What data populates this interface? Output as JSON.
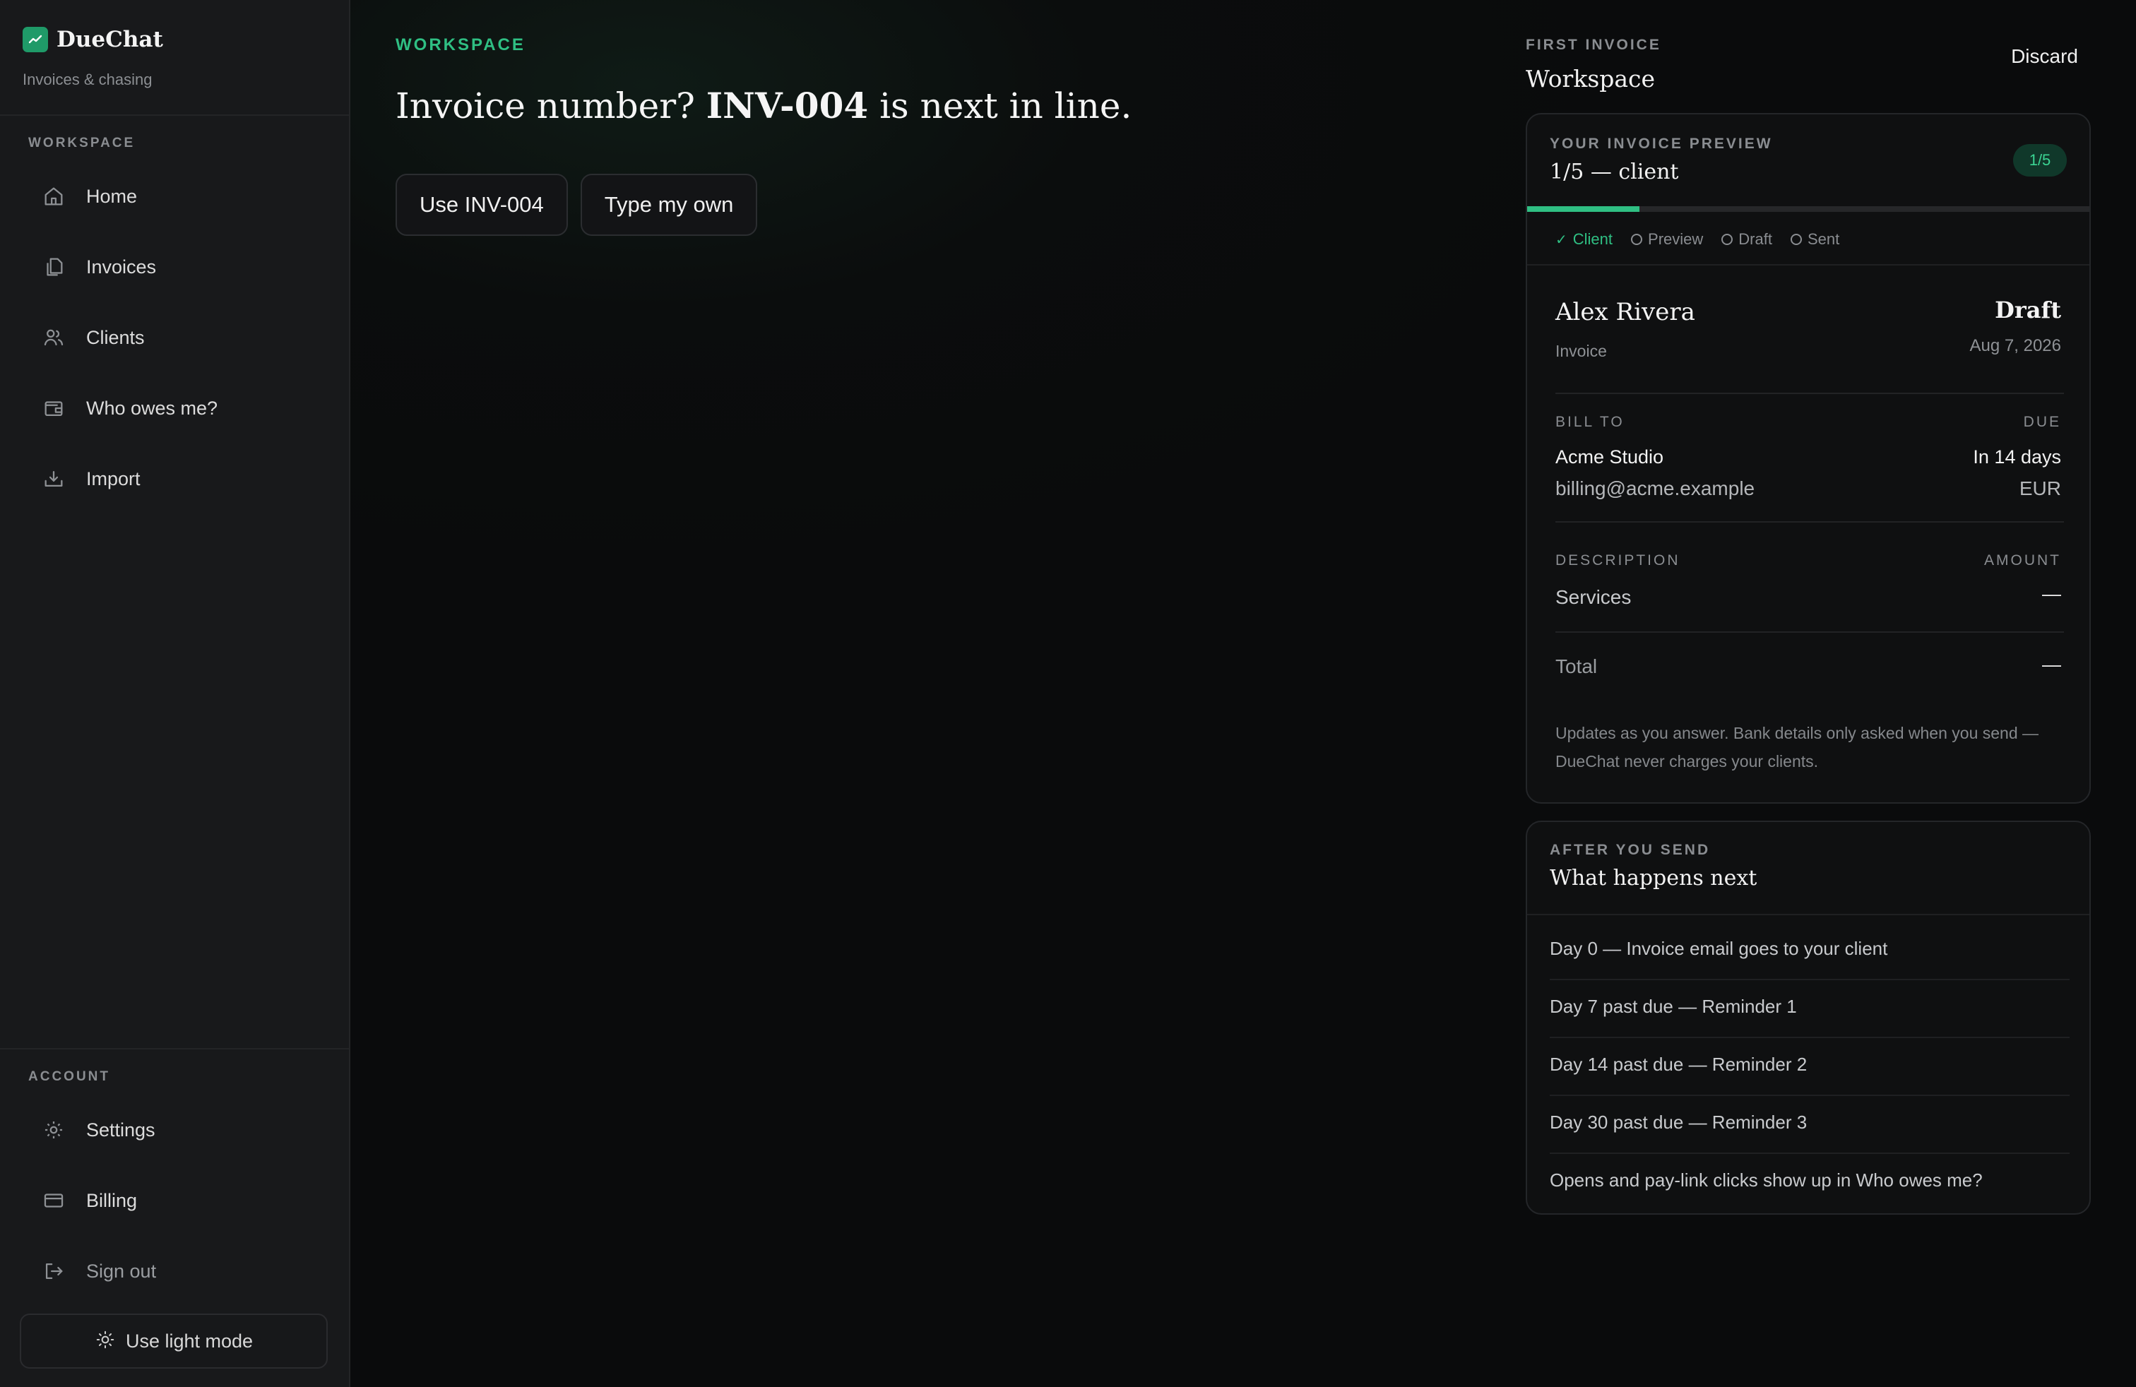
{
  "brand": {
    "name": "DueChat",
    "subtitle": "Invoices & chasing"
  },
  "sidebar": {
    "workspace_heading": "WORKSPACE",
    "items": [
      {
        "label": "Home",
        "icon": "home-icon"
      },
      {
        "label": "Invoices",
        "icon": "documents-icon"
      },
      {
        "label": "Clients",
        "icon": "users-icon"
      },
      {
        "label": "Who owes me?",
        "icon": "wallet-icon"
      },
      {
        "label": "Import",
        "icon": "import-icon"
      }
    ],
    "account_heading": "ACCOUNT",
    "account_items": [
      {
        "label": "Settings",
        "icon": "gear-icon"
      },
      {
        "label": "Billing",
        "icon": "credit-card-icon"
      },
      {
        "label": "Sign out",
        "icon": "sign-out-icon"
      }
    ],
    "light_mode_label": "Use light mode"
  },
  "main": {
    "eyebrow": "WORKSPACE",
    "question_prefix": "Invoice number? ",
    "question_highlight": "INV-004",
    "question_suffix": " is next in line.",
    "choices": [
      "Use INV-004",
      "Type my own"
    ]
  },
  "panel": {
    "eyebrow": "FIRST INVOICE",
    "title": "Workspace",
    "discard_label": "Discard",
    "preview": {
      "eyebrow": "YOUR INVOICE PREVIEW",
      "title": "1/5 — client",
      "badge": "1/5",
      "progress": 0.2,
      "steps": [
        {
          "label": "Client",
          "done": true
        },
        {
          "label": "Preview",
          "done": false
        },
        {
          "label": "Draft",
          "done": false
        },
        {
          "label": "Sent",
          "done": false
        }
      ],
      "client_name": "Alex Rivera",
      "doc_type": "Invoice",
      "status": "Draft",
      "date": "Aug 7, 2026",
      "bill_to_label": "BILL TO",
      "bill_to_name": "Acme Studio",
      "bill_to_email": "billing@acme.example",
      "due_label": "DUE",
      "due_value": "In 14 days",
      "currency": "EUR",
      "description_label": "DESCRIPTION",
      "amount_label": "AMOUNT",
      "line_item": "Services",
      "line_amount": "—",
      "total_label": "Total",
      "total_value": "—",
      "note": "Updates as you answer. Bank details only asked when you send — DueChat never charges your clients."
    },
    "next": {
      "eyebrow": "AFTER YOU SEND",
      "title": "What happens next",
      "rows": [
        "Day 0 — Invoice email goes to your client",
        "Day 7 past due — Reminder 1",
        "Day 14 past due — Reminder 2",
        "Day 30 past due — Reminder 3",
        "Opens and pay-link clicks show up in Who owes me?"
      ]
    }
  },
  "colors": {
    "accent": "#2fbf83",
    "background": "#0a0b0c",
    "sidebar": "#18191b"
  }
}
